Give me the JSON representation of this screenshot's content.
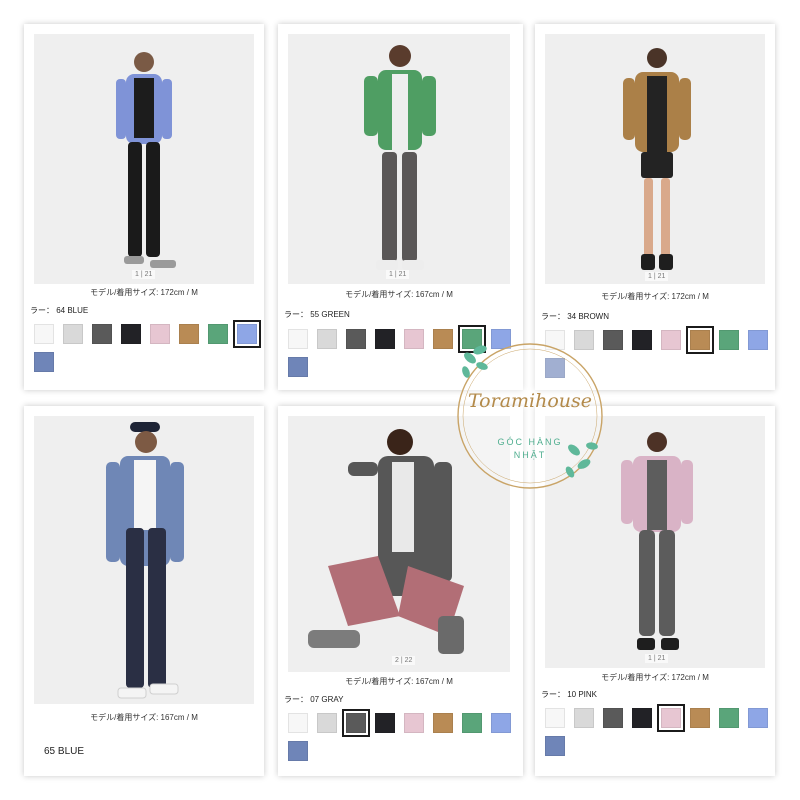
{
  "cards": [
    {
      "id": "blue-64",
      "counter": "1 | 21",
      "meta": "モデル/着用サイズ: 172cm / M",
      "color_label": "ラー：  64 BLUE",
      "jacket": "#7f93d7",
      "top": "#1c1c1c",
      "bottom": "#1a1a1a",
      "swatches": [
        "#f7f7f7",
        "#d9d9d9",
        "#5a5a5a",
        "#222226",
        "#e7c6d2",
        "#b98b55",
        "#5aa57a",
        "#8ea6e6",
        "#6f85b8"
      ],
      "selected": 7
    },
    {
      "id": "green-55",
      "counter": "1 | 21",
      "meta": "モデル/着用サイズ: 167cm / M",
      "color_label": "ラー：  55 GREEN",
      "jacket": "#4f9e63",
      "top": "#eeeeee",
      "bottom": "#5a5757",
      "swatches": [
        "#f7f7f7",
        "#d9d9d9",
        "#5a5a5a",
        "#222226",
        "#e7c6d2",
        "#b98b55",
        "#5aa57a",
        "#8ea6e6",
        "#6f85b8"
      ],
      "selected": 6
    },
    {
      "id": "brown-34",
      "counter": "1 | 21",
      "meta": "モデル/着用サイズ: 172cm / M",
      "color_label": "ラー：  34 BROWN",
      "jacket": "#ab8048",
      "top": "#232323",
      "bottom": "#232323",
      "swatches": [
        "#f7f7f7",
        "#d9d9d9",
        "#5a5a5a",
        "#222226",
        "#e7c6d2",
        "#b98b55",
        "#5aa57a",
        "#8ea6e6",
        "#6f85b8"
      ],
      "selected": 5
    },
    {
      "id": "blue-65",
      "counter": "",
      "meta": "モデル/着用サイズ: 167cm / M",
      "big_color": "65 BLUE",
      "jacket": "#6f87b6",
      "top": "#f5f5f5",
      "bottom": "#2a2f44",
      "swatches": [],
      "selected": -1
    },
    {
      "id": "gray-07",
      "counter": "2 | 22",
      "meta": "モデル/着用サイズ: 167cm / M",
      "color_label": "ラー：  07 GRAY",
      "jacket": "#575757",
      "top": "#e9e9e9",
      "bottom": "#b26e76",
      "swatches": [
        "#f7f7f7",
        "#d9d9d9",
        "#5a5a5a",
        "#222226",
        "#e7c6d2",
        "#b98b55",
        "#5aa57a",
        "#8ea6e6",
        "#6f85b8"
      ],
      "selected": 2
    },
    {
      "id": "pink-10",
      "counter": "1 | 21",
      "meta": "モデル/着用サイズ: 172cm / M",
      "color_label": "ラー：  10 PINK",
      "jacket": "#d9b3c6",
      "top": "#5d5d5d",
      "bottom": "#5c5c5c",
      "swatches": [
        "#f7f7f7",
        "#d9d9d9",
        "#5a5a5a",
        "#222226",
        "#e7c6d2",
        "#b98b55",
        "#5aa57a",
        "#8ea6e6",
        "#6f85b8"
      ],
      "selected": 4
    }
  ],
  "watermark": {
    "name": "Toramihouse",
    "tagline_line1": "GÓC HÀNG",
    "tagline_line2": "NHẬT",
    "gold": "#c9a467",
    "leaf": "#5fb89a"
  }
}
